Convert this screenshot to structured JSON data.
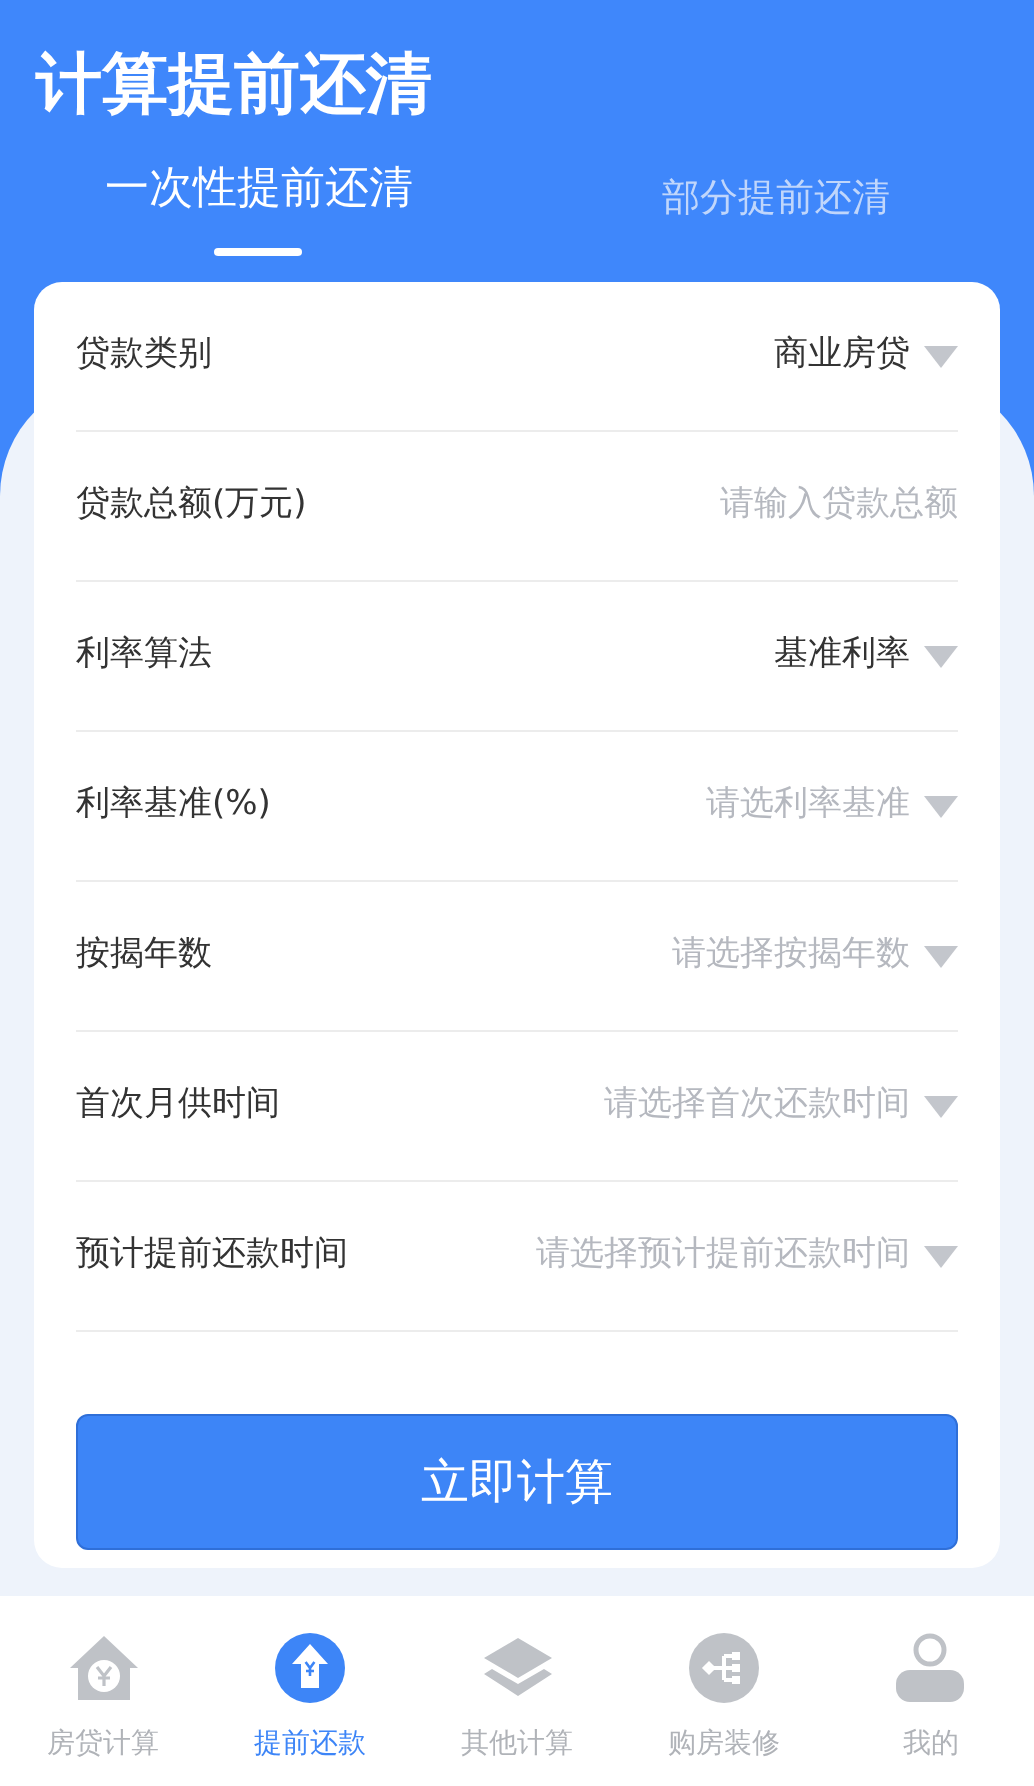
{
  "title": "计算提前还清",
  "tabs": [
    {
      "label": "一次性提前还清",
      "selected": true
    },
    {
      "label": "部分提前还清",
      "selected": false
    }
  ],
  "form": [
    {
      "kind": "select",
      "label": "贷款类别",
      "value": "商业房贷"
    },
    {
      "kind": "input",
      "label": "贷款总额(万元)",
      "placeholder": "请输入贷款总额"
    },
    {
      "kind": "select",
      "label": "利率算法",
      "value": "基准利率"
    },
    {
      "kind": "select",
      "label": "利率基准(%)",
      "placeholder": "请选利率基准"
    },
    {
      "kind": "select",
      "label": "按揭年数",
      "placeholder": "请选择按揭年数"
    },
    {
      "kind": "select",
      "label": "首次月供时间",
      "placeholder": "请选择首次还款时间"
    },
    {
      "kind": "select",
      "label": "预计提前还款时间",
      "placeholder": "请选择预计提前还款时间"
    }
  ],
  "submit": "立即计算",
  "nav": [
    {
      "kind": "house",
      "label": "房贷计算",
      "selected": false
    },
    {
      "kind": "prepay",
      "label": "提前还款",
      "selected": true
    },
    {
      "kind": "layers",
      "label": "其他计算",
      "selected": false
    },
    {
      "kind": "flow",
      "label": "购房装修",
      "selected": false
    },
    {
      "kind": "user",
      "label": "我的",
      "selected": false
    }
  ]
}
